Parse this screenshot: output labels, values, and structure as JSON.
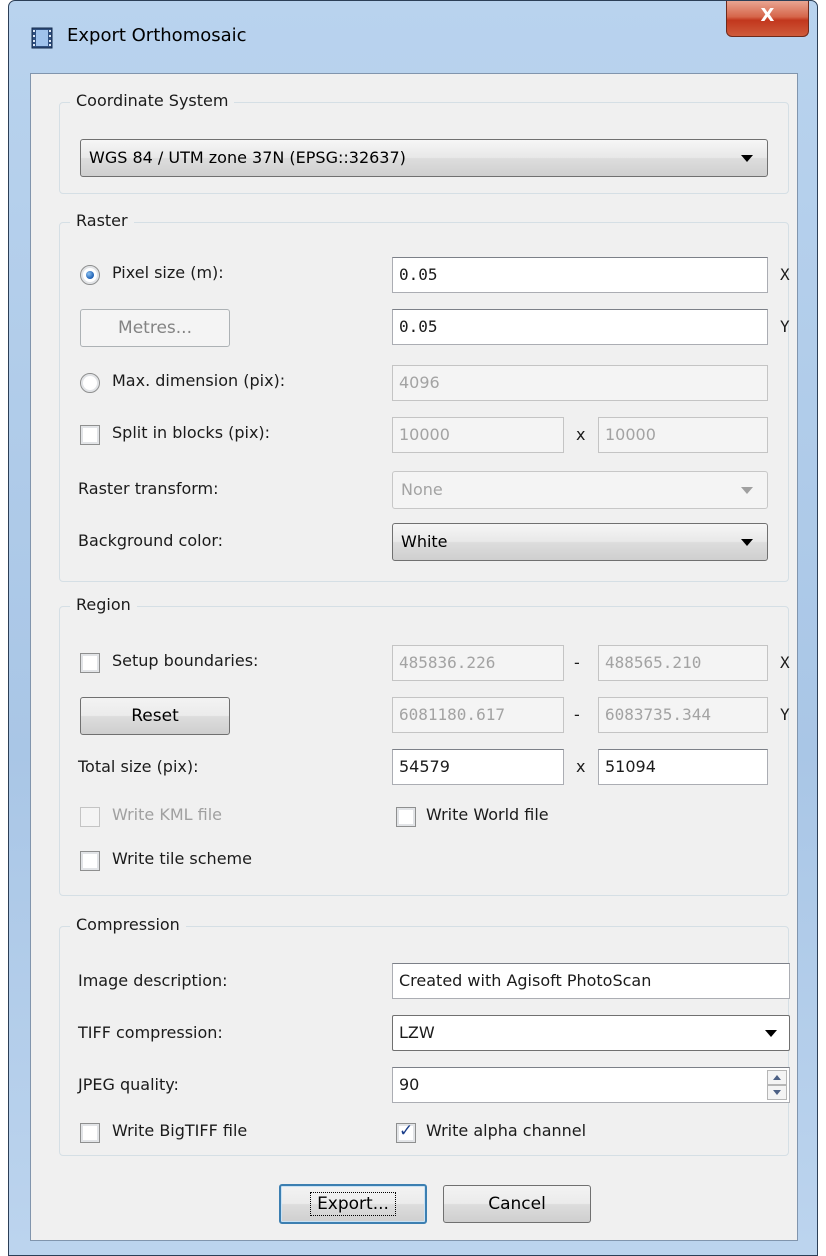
{
  "window": {
    "title": "Export Orthomosaic",
    "close_label": "X"
  },
  "coordinate_system": {
    "group_title": "Coordinate System",
    "value": "WGS 84 / UTM zone 37N (EPSG::32637)"
  },
  "raster": {
    "group_title": "Raster",
    "pixel_size_label": "Pixel size (m):",
    "pixel_size_selected": true,
    "pixel_x": "0.05",
    "pixel_y": "0.05",
    "axis_x": "X",
    "axis_y": "Y",
    "metres_button": "Metres...",
    "max_dimension_label": "Max. dimension (pix):",
    "max_dimension_value": "4096",
    "split_label": "Split in blocks (pix):",
    "split_x": "10000",
    "split_sep": "x",
    "split_y": "10000",
    "transform_label": "Raster transform:",
    "transform_value": "None",
    "background_label": "Background color:",
    "background_value": "White"
  },
  "region": {
    "group_title": "Region",
    "setup_label": "Setup boundaries:",
    "x_min": "485836.226",
    "x_max": "488565.210",
    "y_min": "6081180.617",
    "y_max": "6083735.344",
    "dash": "-",
    "axis_x": "X",
    "axis_y": "Y",
    "reset_button": "Reset",
    "total_size_label": "Total size (pix):",
    "total_w": "54579",
    "total_sep": "x",
    "total_h": "51094",
    "kml_label": "Write KML file",
    "world_label": "Write World file",
    "tile_label": "Write tile scheme"
  },
  "compression": {
    "group_title": "Compression",
    "description_label": "Image description:",
    "description_value": "Created with Agisoft PhotoScan",
    "tiff_label": "TIFF compression:",
    "tiff_value": "LZW",
    "jpeg_label": "JPEG quality:",
    "jpeg_value": "90",
    "bigtiff_label": "Write BigTIFF file",
    "alpha_label": "Write alpha channel",
    "alpha_checked": true
  },
  "footer": {
    "export_button": "Export...",
    "cancel_button": "Cancel"
  }
}
